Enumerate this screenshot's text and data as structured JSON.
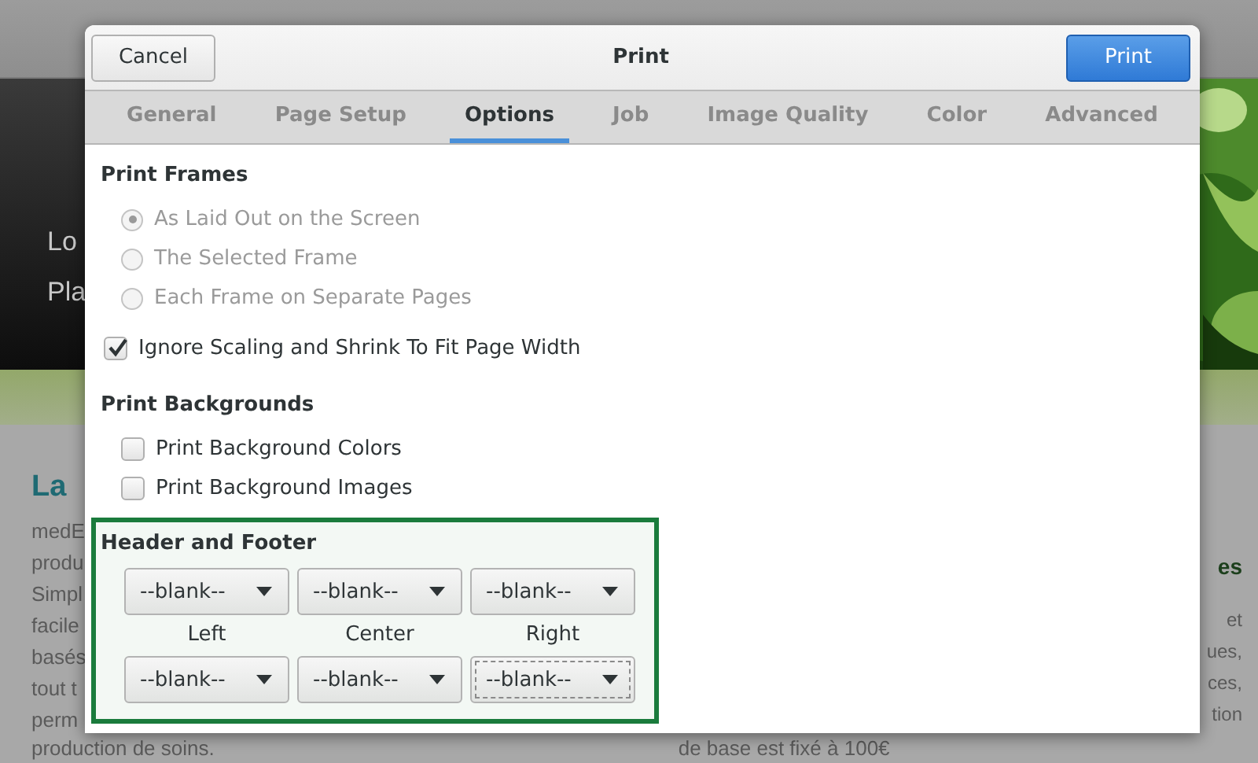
{
  "background_page": {
    "header_lines": [
      "Lo",
      "Pla"
    ],
    "heading": "La",
    "left_lines": [
      "medE",
      "produ",
      "Simpl",
      "facile",
      "basés",
      "tout t",
      "perm"
    ],
    "right_heading": "es",
    "right_lines": [
      "et",
      "ues,",
      "ces,",
      "tion"
    ],
    "bottom_left": "production de soins.",
    "bottom_right": "de base est fixé à 100€"
  },
  "dialog": {
    "title": "Print",
    "cancel_button": "Cancel",
    "print_button": "Print",
    "tabs": [
      {
        "label": "General",
        "selected": false
      },
      {
        "label": "Page Setup",
        "selected": false
      },
      {
        "label": "Options",
        "selected": true
      },
      {
        "label": "Job",
        "selected": false
      },
      {
        "label": "Image Quality",
        "selected": false
      },
      {
        "label": "Color",
        "selected": false
      },
      {
        "label": "Advanced",
        "selected": false
      }
    ],
    "print_frames": {
      "title": "Print Frames",
      "options": [
        {
          "label": "As Laid Out on the Screen",
          "selected": true,
          "disabled": true
        },
        {
          "label": "The Selected Frame",
          "selected": false,
          "disabled": true
        },
        {
          "label": "Each Frame on Separate Pages",
          "selected": false,
          "disabled": true
        }
      ]
    },
    "ignore_scaling": {
      "label": "Ignore Scaling and Shrink To Fit Page Width",
      "checked": true
    },
    "print_backgrounds": {
      "title": "Print Backgrounds",
      "options": [
        {
          "label": "Print Background Colors",
          "checked": false
        },
        {
          "label": "Print Background Images",
          "checked": false
        }
      ]
    },
    "header_footer": {
      "title": "Header and Footer",
      "headers": [
        {
          "value": "--blank--",
          "focused": false
        },
        {
          "value": "--blank--",
          "focused": false
        },
        {
          "value": "--blank--",
          "focused": false
        }
      ],
      "column_labels": [
        "Left",
        "Center",
        "Right"
      ],
      "footers": [
        {
          "value": "--blank--",
          "focused": false
        },
        {
          "value": "--blank--",
          "focused": false
        },
        {
          "value": "--blank--",
          "focused": true
        }
      ]
    }
  }
}
